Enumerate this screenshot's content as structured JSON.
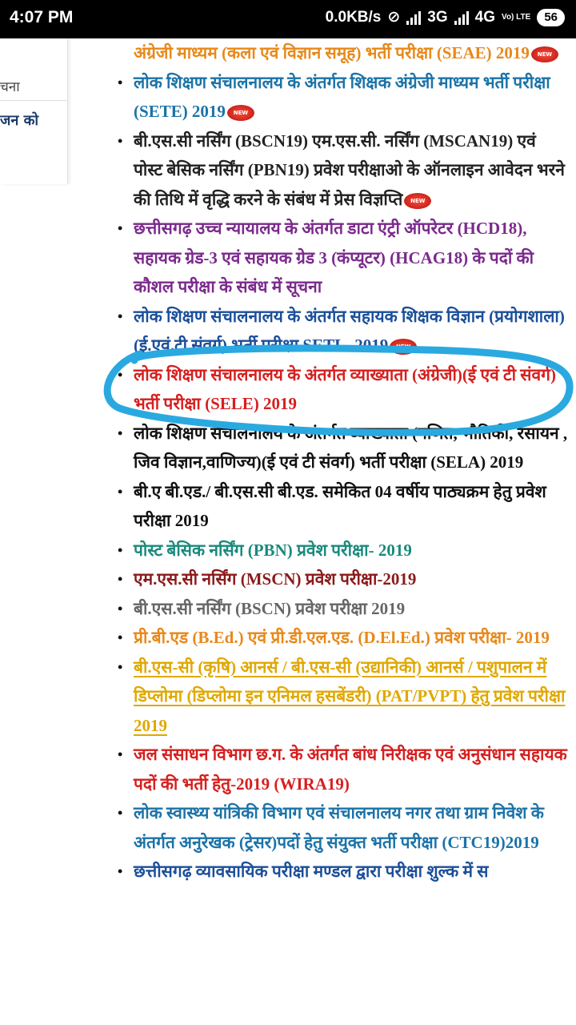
{
  "status_bar": {
    "time": "4:07 PM",
    "speed": "0.0KB/s",
    "net1": "3G",
    "net2": "4G",
    "volte": "Vo) LTE",
    "battery": "56"
  },
  "sidebar": {
    "item1": "चना",
    "item2": "जन को"
  },
  "badge_text": "NEW",
  "items": [
    {
      "text": "अंग्रेजी माध्यम (कला एवं विज्ञान समूह) भर्ती परीक्षा (SEAE) 2019",
      "color": "#e8891a",
      "new": true,
      "underline": false
    },
    {
      "text": "लोक शिक्षण संचालनालय के अंतर्गत शिक्षक अंग्रेजी माध्यम भर्ती परीक्षा (SETE) 2019",
      "color": "#1b73a8",
      "new": true,
      "underline": false
    },
    {
      "text": "बी.एस.सी नर्सिंग (BSCN19) एम.एस.सी. नर्सिंग (MSCAN19) एवं पोस्ट बेसिक नर्सिंग (PBN19) प्रवेश परीक्षाओ के ऑनलाइन आवेदन भरने की तिथि में वृद्धि करने के संबंध में प्रेस विज्ञप्ति",
      "color": "#222222",
      "new": true,
      "underline": false
    },
    {
      "text": "छत्तीसगढ़ उच्च न्यायालय के अंतर्गत डाटा एंट्री ऑपरेटर (HCD18), सहायक ग्रेड-3 एवं सहायक ग्रेड 3 (कंप्यूटर) (HCAG18) के पदों की कौशल परीक्षा के संबंध में सूचना",
      "color": "#7b2a8c",
      "new": false,
      "underline": false
    },
    {
      "text": "लोक शिक्षण संचालनालय के अंतर्गत सहायक शिक्षक विज्ञान (प्रयोगशाला) (ई.एवं.टी संवर्ग) भर्ती परीक्षा SETL -2019",
      "color": "#1b4f9a",
      "new": true,
      "underline": false
    },
    {
      "text": "लोक शिक्षण संचालनालय के अंतर्गत व्याख्याता (अंग्रेजी)(ई एवं टी संवर्ग) भर्ती परीक्षा (SELE) 2019",
      "color": "#d61f1f",
      "new": false,
      "underline": false
    },
    {
      "text": "लोक शिक्षण संचालनालय के अंतर्गत व्याख्याता (गणित, भौतिकी, रसायन , जिव विज्ञान,वाणिज्य)(ई एवं टी संवर्ग) भर्ती परीक्षा (SELA) 2019",
      "color": "#111111",
      "new": false,
      "underline": false
    },
    {
      "text": "बी.ए बी.एड./ बी.एस.सी बी.एड. समेकित 04 वर्षीय पाठ्यक्रम हेतु प्रवेश परीक्षा 2019",
      "color": "#111111",
      "new": false,
      "underline": false
    },
    {
      "text": "पोस्ट बेसिक नर्सिंग (PBN) प्रवेश परीक्षा- 2019",
      "color": "#1a8a7c",
      "new": false,
      "underline": false
    },
    {
      "text": "एम.एस.सी नर्सिंग (MSCN) प्रवेश परीक्षा-2019",
      "color": "#8b1a1a",
      "new": false,
      "underline": false
    },
    {
      "text": "बी.एस.सी नर्सिंग (BSCN) प्रवेश परीक्षा 2019",
      "color": "#666666",
      "new": false,
      "underline": false
    },
    {
      "text": "प्री.बी.एड (B.Ed.) एवं प्री.डी.एल.एड. (D.El.Ed.) प्रवेश परीक्षा- 2019",
      "color": "#e8891a",
      "new": false,
      "underline": false
    },
    {
      "text": "बी.एस-सी (कृषि) आनर्स / बी.एस-सी (उद्यानिकी) आनर्स / पशुपालन में डिप्लोमा (डिप्लोमा इन एनिमल हसबेंडरी) (PAT/PVPT) हेतु प्रवेश परीक्षा 2019",
      "color": "#e0a800",
      "new": false,
      "underline": true
    },
    {
      "text": "जल संसाधन विभाग छ.ग. के अंतर्गत बांध निरीक्षक एवं अनुसंधान सहायक पदों की भर्ती हेतु-2019 (WIRA19)",
      "color": "#d61f1f",
      "new": false,
      "underline": false
    },
    {
      "text": "लोक स्वास्थ्य यांत्रिकी विभाग एवं संचालनालय नगर तथा ग्राम निवेश के अंतर्गत अनुरेखक (ट्रेसर)पदों हेतु संयुक्त भर्ती परीक्षा (CTC19)2019",
      "color": "#1b73a8",
      "new": false,
      "underline": false
    },
    {
      "text": "छत्तीसगढ़ व्यावसायिक परीक्षा मण्डल द्वारा परीक्षा शुल्क में स",
      "color": "#1b4f9a",
      "new": false,
      "underline": false
    }
  ]
}
